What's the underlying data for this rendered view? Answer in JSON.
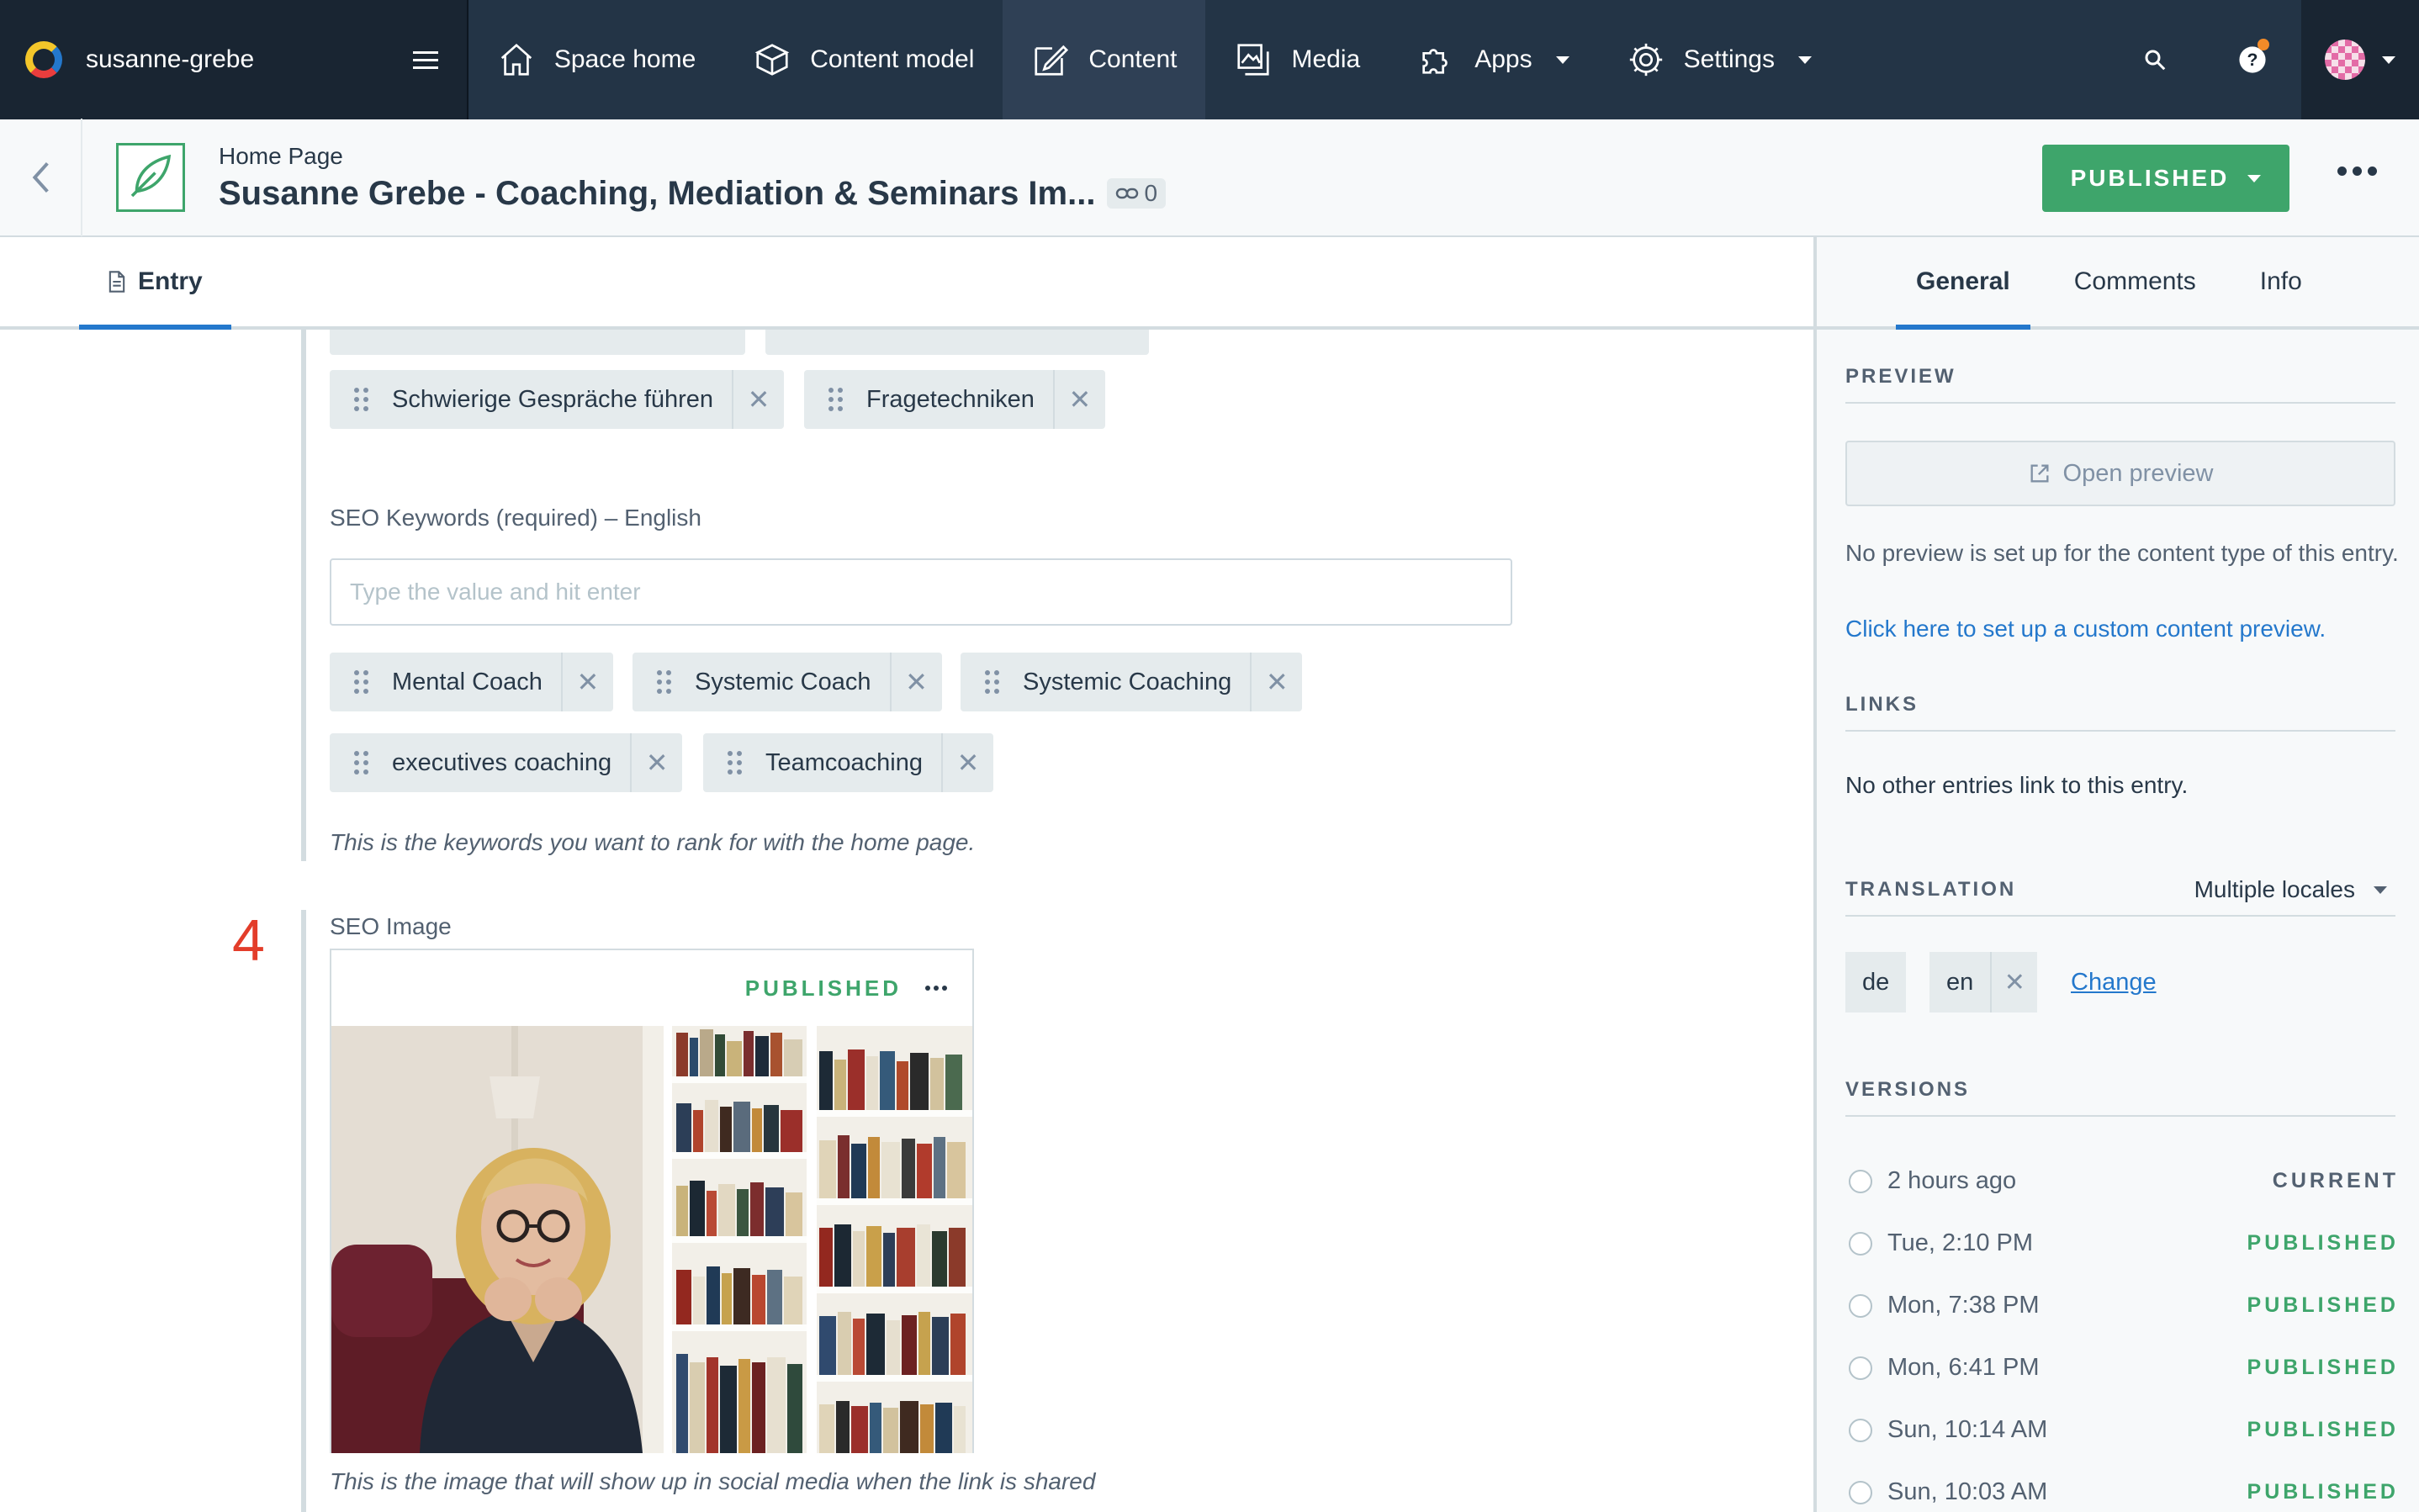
{
  "app": {
    "space_name": "susanne-grebe",
    "nav": [
      {
        "label": "Space home",
        "icon": "home-icon"
      },
      {
        "label": "Content model",
        "icon": "content-model-icon"
      },
      {
        "label": "Content",
        "icon": "content-icon",
        "active": true
      },
      {
        "label": "Media",
        "icon": "media-icon"
      },
      {
        "label": "Apps",
        "icon": "apps-icon",
        "dropdown": true
      },
      {
        "label": "Settings",
        "icon": "gear-icon",
        "dropdown": true
      }
    ]
  },
  "entry": {
    "content_type": "Home Page",
    "title": "Susanne Grebe - Coaching, Mediation & Seminars Im...",
    "links_count": "0",
    "status_button": "PUBLISHED",
    "tab_entry": "Entry"
  },
  "fields": {
    "prev_pills": [
      "Schwierige Gespräche führen",
      "Fragetechniken"
    ],
    "seo_keywords_label": "SEO Keywords (required) – English",
    "seo_keywords_placeholder": "Type the value and hit enter",
    "keywords": [
      "Mental Coach",
      "Systemic Coach",
      "Systemic Coaching",
      "executives coaching",
      "Teamcoaching"
    ],
    "seo_keywords_help": "This is the keywords you want to rank for with the home page.",
    "annotation_number": "4",
    "seo_image_label": "SEO Image",
    "seo_image_status": "PUBLISHED",
    "seo_image_help": "This is the image that will show up in social media when the link is shared"
  },
  "sidebar": {
    "tabs": [
      "General",
      "Comments",
      "Info"
    ],
    "preview_heading": "PREVIEW",
    "open_preview": "Open preview",
    "preview_note": "No preview is set up for the content type of this entry.",
    "preview_link": "Click here to set up a custom content preview.",
    "links_heading": "LINKS",
    "links_note": "No other entries link to this entry.",
    "translation_heading": "TRANSLATION",
    "translation_select": "Multiple locales",
    "locales": [
      "de",
      "en"
    ],
    "change_link": "Change",
    "versions_heading": "VERSIONS",
    "versions": [
      {
        "time": "2 hours ago",
        "status": "CURRENT"
      },
      {
        "time": "Tue, 2:10 PM",
        "status": "PUBLISHED"
      },
      {
        "time": "Mon, 7:38 PM",
        "status": "PUBLISHED"
      },
      {
        "time": "Mon, 6:41 PM",
        "status": "PUBLISHED"
      },
      {
        "time": "Sun, 10:14 AM",
        "status": "PUBLISHED"
      },
      {
        "time": "Sun, 10:03 AM",
        "status": "PUBLISHED"
      }
    ]
  },
  "colors": {
    "nav_bg": "#192532",
    "accent_blue": "#2478cc",
    "published_green": "#3ea56b",
    "annotation_red": "#e33d2a"
  }
}
